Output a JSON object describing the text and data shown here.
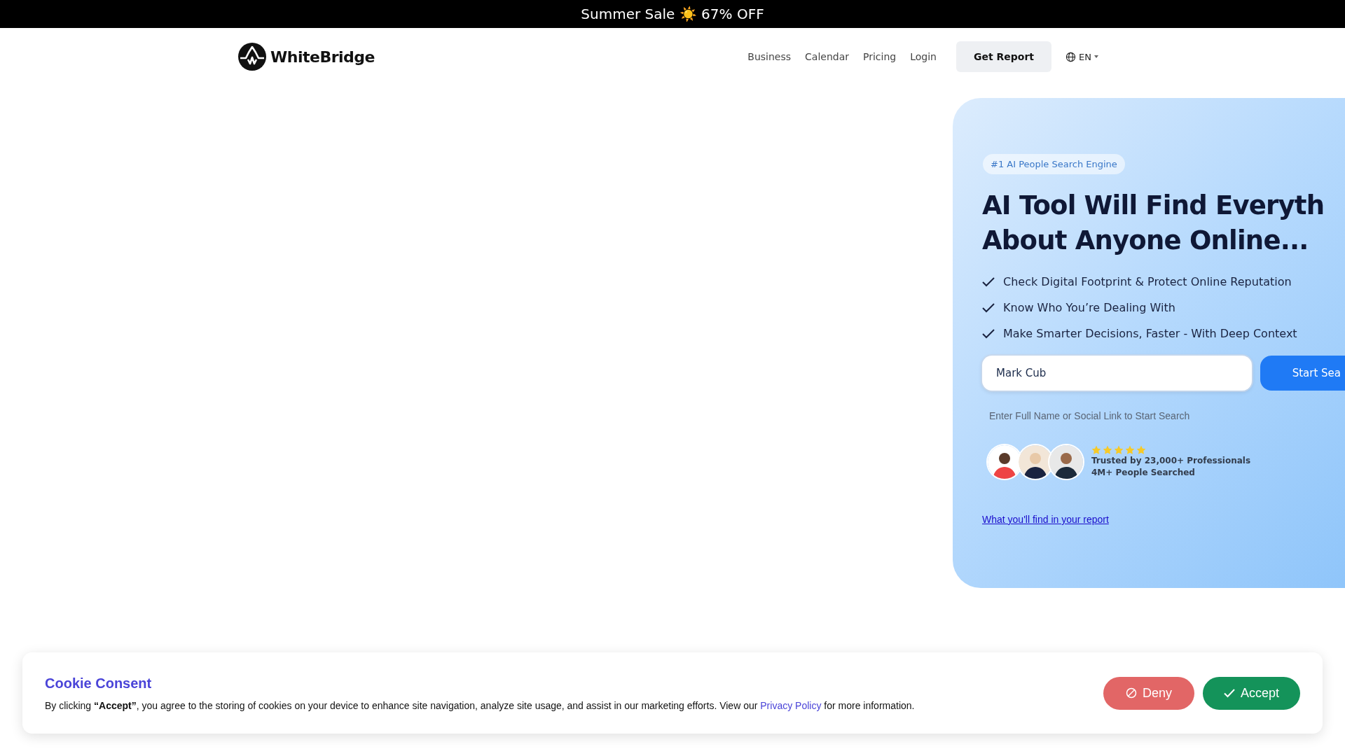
{
  "announcement": "Summer Sale ☀️ 67% OFF",
  "header": {
    "logo": "WhiteBridge",
    "nav": [
      "Business",
      "Calendar",
      "Pricing",
      "Login"
    ],
    "cta": "Get Report",
    "language": "EN"
  },
  "hero": {
    "badge": "#1 AI People Search Engine",
    "title_lines": [
      "AI Tool Will Find Everyth",
      "About Anyone Online..."
    ],
    "features": [
      "Check Digital Footprint & Protect Online Reputation",
      "Know Who You’re Dealing With",
      "Make Smarter Decisions, Faster - With Deep Context"
    ],
    "search": {
      "value": "Mark Cub",
      "button": "Start Sea"
    },
    "hint": "Enter Full Name or Social Link to Start Search",
    "rating": {
      "stars": 5,
      "lines": [
        "Trusted by 23,000+ Professionals",
        "4M+ People Searched"
      ]
    },
    "link": "What you'll find in your report"
  },
  "cookie": {
    "title": "Cookie Consent",
    "text": "By clicking **“Accept”**, you agree to the storing of cookies on your device to enhance site navigation, analyze site usage, and assist in our marketing efforts. View our",
    "link": "Privacy Policy",
    "text_after": "for more information.",
    "deny": "Deny",
    "accept": "Accept"
  }
}
